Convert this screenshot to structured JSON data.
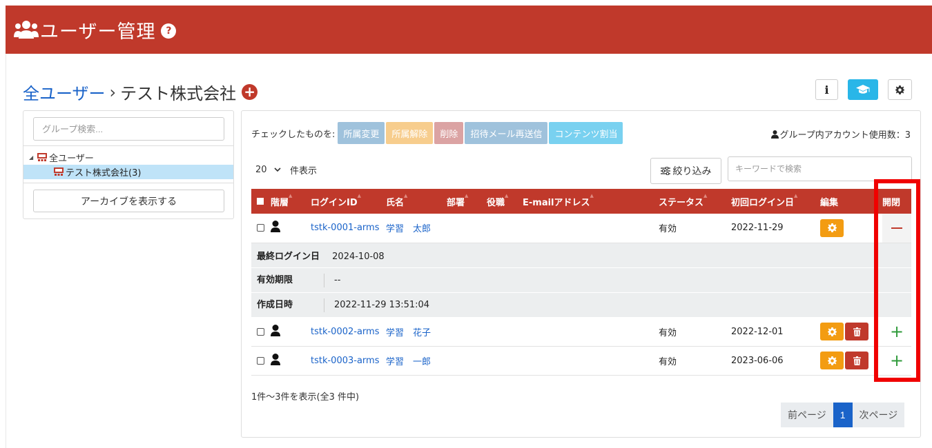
{
  "header": {
    "title": "ユーザー管理",
    "help": "?"
  },
  "breadcrumb": {
    "root": "全ユーザー",
    "separator": "›",
    "current": "テスト株式会社"
  },
  "toolbar": {
    "info": "i"
  },
  "sidebar": {
    "search_placeholder": "グループ検索...",
    "tree": [
      {
        "label": "全ユーザー"
      },
      {
        "label": "テスト株式会社(3)"
      }
    ],
    "archive_button": "アーカイブを表示する"
  },
  "bulk": {
    "label": "チェックしたものを:",
    "actions": [
      "所属変更",
      "所属解除",
      "削除",
      "招待メール再送信",
      "コンテンツ割当"
    ]
  },
  "usage": "グループ内アカウント使用数：3",
  "per_page": {
    "value": "20",
    "suffix": "件表示"
  },
  "filter_button": "絞り込み",
  "keyword_placeholder": "キーワードで検索",
  "table": {
    "headers": [
      "階層",
      "ログインID",
      "氏名",
      "部署",
      "役職",
      "E-mailアドレス",
      "ステータス",
      "初回ログイン日",
      "編集",
      "開閉"
    ],
    "rows": [
      {
        "login_id": "tstk-0001-arms",
        "name": "学習　太郎",
        "status": "有効",
        "first_login": "2022-11-29"
      },
      {
        "login_id": "tstk-0002-arms",
        "name": "学習　花子",
        "status": "有効",
        "first_login": "2022-12-01"
      },
      {
        "login_id": "tstk-0003-arms",
        "name": "学習　一郎",
        "status": "有効",
        "first_login": "2023-06-06"
      }
    ],
    "details": [
      {
        "label": "最終ログイン日",
        "value": "2024-10-08"
      },
      {
        "label": "有効期限",
        "value": "--"
      },
      {
        "label": "作成日時",
        "value": "2022-11-29 13:51:04"
      }
    ],
    "toggle_plus": "+"
  },
  "summary": "1件～3件を表示(全3 件中)",
  "pagination": {
    "prev": "前ページ",
    "current": "1",
    "next": "次ページ"
  },
  "colors": {
    "brand": "#c0392b",
    "link": "#1a63c9",
    "highlight": "#f00000"
  }
}
